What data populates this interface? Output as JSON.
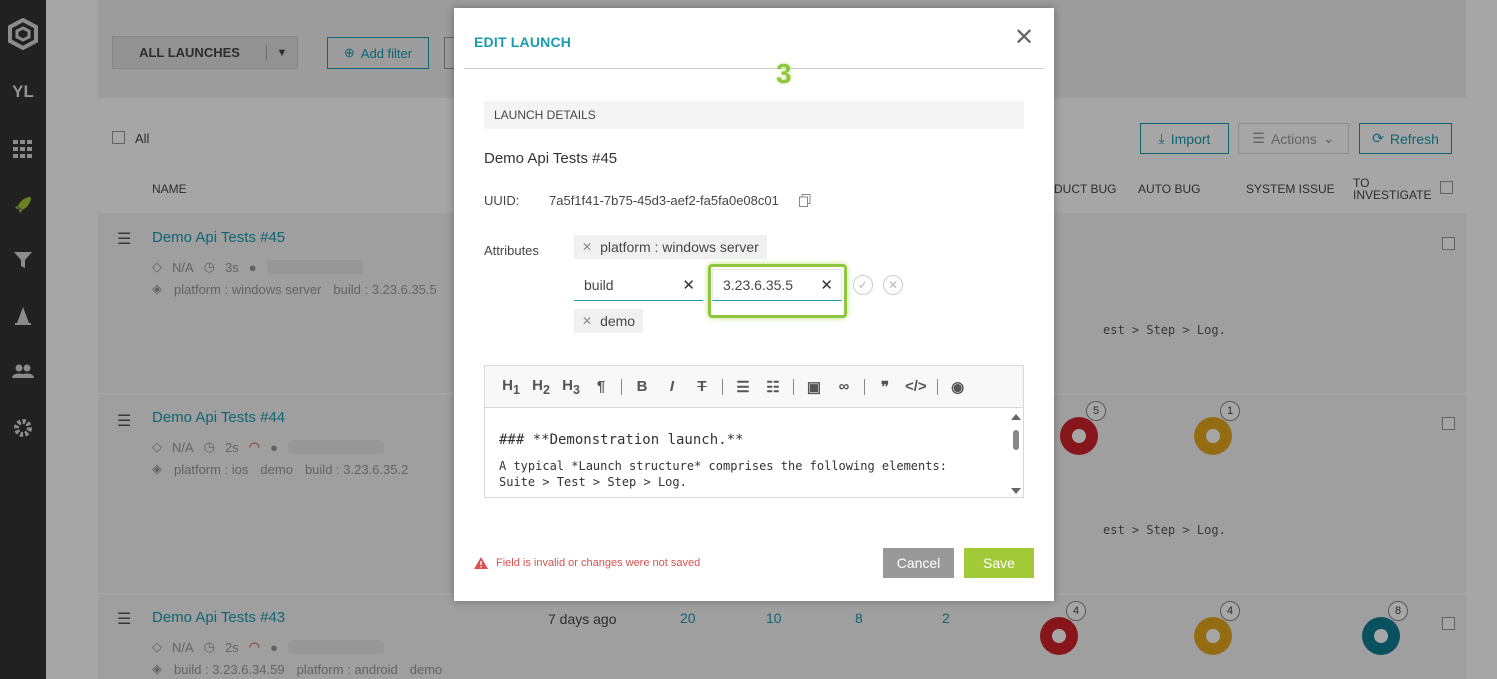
{
  "sidebar": {
    "user_initials": "YL"
  },
  "filter_bar": {
    "launch_select": "ALL LAUNCHES",
    "add_filter": "Add filter"
  },
  "list": {
    "all_label": "All",
    "col_name": "NAME",
    "col_product_bug": "DUCT BUG",
    "col_auto_bug": "AUTO BUG",
    "col_system_issue": "SYSTEM ISSUE",
    "col_to_investigate_1": "TO",
    "col_to_investigate_2": "INVESTIGATE",
    "import_label": "Import",
    "actions_label": "Actions",
    "refresh_label": "Refresh",
    "rows": [
      {
        "title": "Demo Api Tests #45",
        "owner": "N/A",
        "duration": "3s",
        "attrs": [
          "platform : windows server",
          "build : 3.23.6.35.5"
        ]
      },
      {
        "title": "Demo Api Tests #44",
        "owner": "N/A",
        "duration": "2s",
        "attrs": [
          "platform : ios",
          "demo",
          "build : 3.23.6.35.2"
        ],
        "product_bug": "5",
        "auto_bug": "1",
        "trail": "est > Step > Log."
      },
      {
        "title": "Demo Api Tests #43",
        "owner": "N/A",
        "duration": "2s",
        "attrs": [
          "build : 3.23.6.34.59",
          "platform : android",
          "demo"
        ],
        "age": "7 days ago",
        "total": "20",
        "passed": "10",
        "failed": "8",
        "skipped": "2",
        "product_bug": "4",
        "auto_bug": "4",
        "to_investigate": "8"
      }
    ],
    "row1_trail": "est > Step > Log."
  },
  "modal": {
    "title": "EDIT LAUNCH",
    "step_marker": "3",
    "section_title": "LAUNCH DETAILS",
    "launch_name": "Demo Api Tests #45",
    "uuid_label": "UUID:",
    "uuid_value": "7a5f1f41-7b75-45d3-aef2-fa5fa0e08c01",
    "attributes_label": "Attributes",
    "attr_chip_1": "platform : windows server",
    "attr_key_value": "build",
    "attr_value_value": "3.23.6.35.5",
    "attr_chip_2": "demo",
    "editor": {
      "toolbar": [
        "H1",
        "H2",
        "H3",
        "¶",
        "B",
        "I",
        "S",
        "ul",
        "ol",
        "img",
        "link",
        "quote",
        "code",
        "preview"
      ],
      "heading": "### **Demonstration launch.**",
      "line1": "A typical *Launch structure* comprises the following elements:",
      "line2": "Suite > Test > Step > Log."
    },
    "warning": "Field is invalid or changes were not saved",
    "cancel_label": "Cancel",
    "save_label": "Save"
  },
  "colors": {
    "accent": "#1a9cb0",
    "save": "#a2c937",
    "product_bug": "#d0222a",
    "auto_bug": "#e3a71d",
    "to_investigate": "#0f7d8f"
  }
}
